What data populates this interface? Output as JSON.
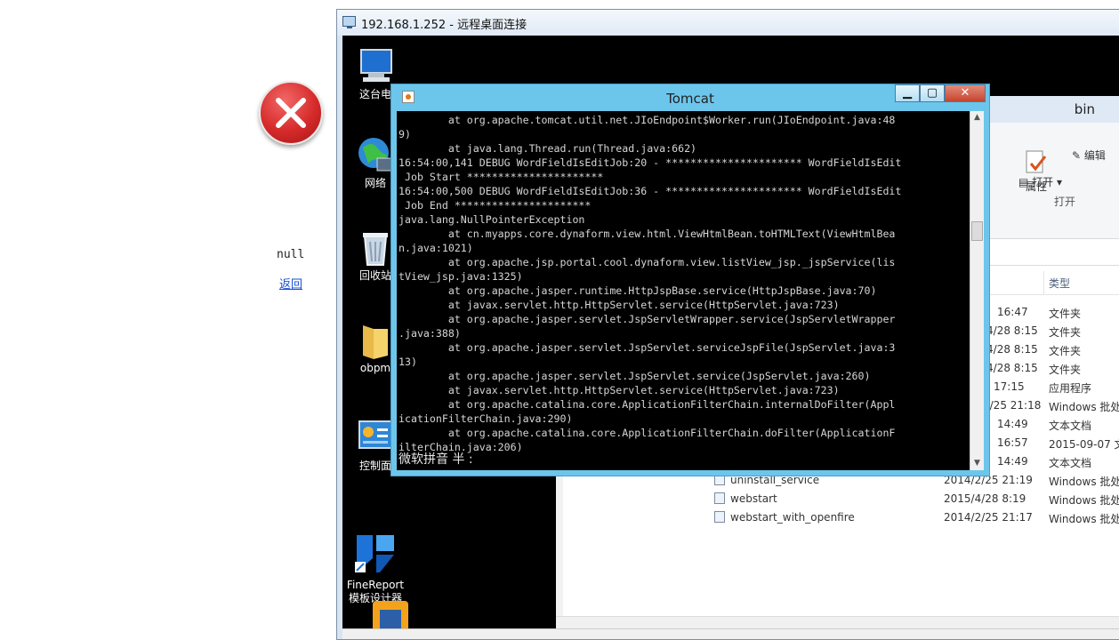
{
  "page": {
    "null_text": "null",
    "back_link": "返回"
  },
  "rdp": {
    "title": "192.168.1.252 - 远程桌面连接"
  },
  "desktop_icons": [
    {
      "label": "这台电",
      "icon": "computer-icon"
    },
    {
      "label": "网络",
      "icon": "network-globe-icon"
    },
    {
      "label": "回收站",
      "icon": "recycle-bin-icon"
    },
    {
      "label": "obpm",
      "icon": "folder-icon"
    },
    {
      "label": "控制面",
      "icon": "control-panel-icon"
    },
    {
      "label": "FineReport\n模板设计器",
      "icon": "finereport-icon"
    }
  ],
  "explorer": {
    "title": "bin",
    "ribbon": {
      "properties": "属性",
      "edit": "编辑",
      "open": "打开",
      "open_group": "打开"
    },
    "column_type": "类型",
    "rows": [
      {
        "date": "16:47",
        "type": "文件夹"
      },
      {
        "date": "/4/28 8:15",
        "type": "文件夹"
      },
      {
        "date": "/4/28 8:15",
        "type": "文件夹"
      },
      {
        "date": "/4/28 8:15",
        "type": "文件夹"
      },
      {
        "date": "17:15",
        "type": "应用程序"
      },
      {
        "date": "2/25 21:18",
        "type": "Windows 批处"
      },
      {
        "date": "14:49",
        "type": "文本文档"
      },
      {
        "date": "16:57",
        "type": "2015-09-07 文"
      },
      {
        "date": "14:49",
        "type": "文本文档"
      },
      {
        "name": "uninstall_service",
        "date": "2014/2/25 21:19",
        "type": "Windows 批处"
      },
      {
        "name": "webstart",
        "date": "2015/4/28 8:19",
        "type": "Windows 批处"
      },
      {
        "name": "webstart_with_openfire",
        "date": "2014/2/25 21:17",
        "type": "Windows 批处"
      }
    ]
  },
  "tomcat": {
    "title": "Tomcat",
    "console_text": "        at org.apache.tomcat.util.net.JIoEndpoint$Worker.run(JIoEndpoint.java:48\n9)\n        at java.lang.Thread.run(Thread.java:662)\n16:54:00,141 DEBUG WordFieldIsEditJob:20 - ********************** WordFieldIsEdit\n Job Start **********************\n16:54:00,500 DEBUG WordFieldIsEditJob:36 - ********************** WordFieldIsEdit\n Job End **********************\njava.lang.NullPointerException\n        at cn.myapps.core.dynaform.view.html.ViewHtmlBean.toHTMLText(ViewHtmlBea\nn.java:1021)\n        at org.apache.jsp.portal.cool.dynaform.view.listView_jsp._jspService(lis\ntView_jsp.java:1325)\n        at org.apache.jasper.runtime.HttpJspBase.service(HttpJspBase.java:70)\n        at javax.servlet.http.HttpServlet.service(HttpServlet.java:723)\n        at org.apache.jasper.servlet.JspServletWrapper.service(JspServletWrapper\n.java:388)\n        at org.apache.jasper.servlet.JspServlet.serviceJspFile(JspServlet.java:3\n13)\n        at org.apache.jasper.servlet.JspServlet.service(JspServlet.java:260)\n        at javax.servlet.http.HttpServlet.service(HttpServlet.java:723)\n        at org.apache.catalina.core.ApplicationFilterChain.internalDoFilter(Appl\nicationFilterChain.java:290)\n        at org.apache.catalina.core.ApplicationFilterChain.doFilter(ApplicationF\nilterChain.java:206)",
    "ime_text": "微软拼音 半 :"
  }
}
